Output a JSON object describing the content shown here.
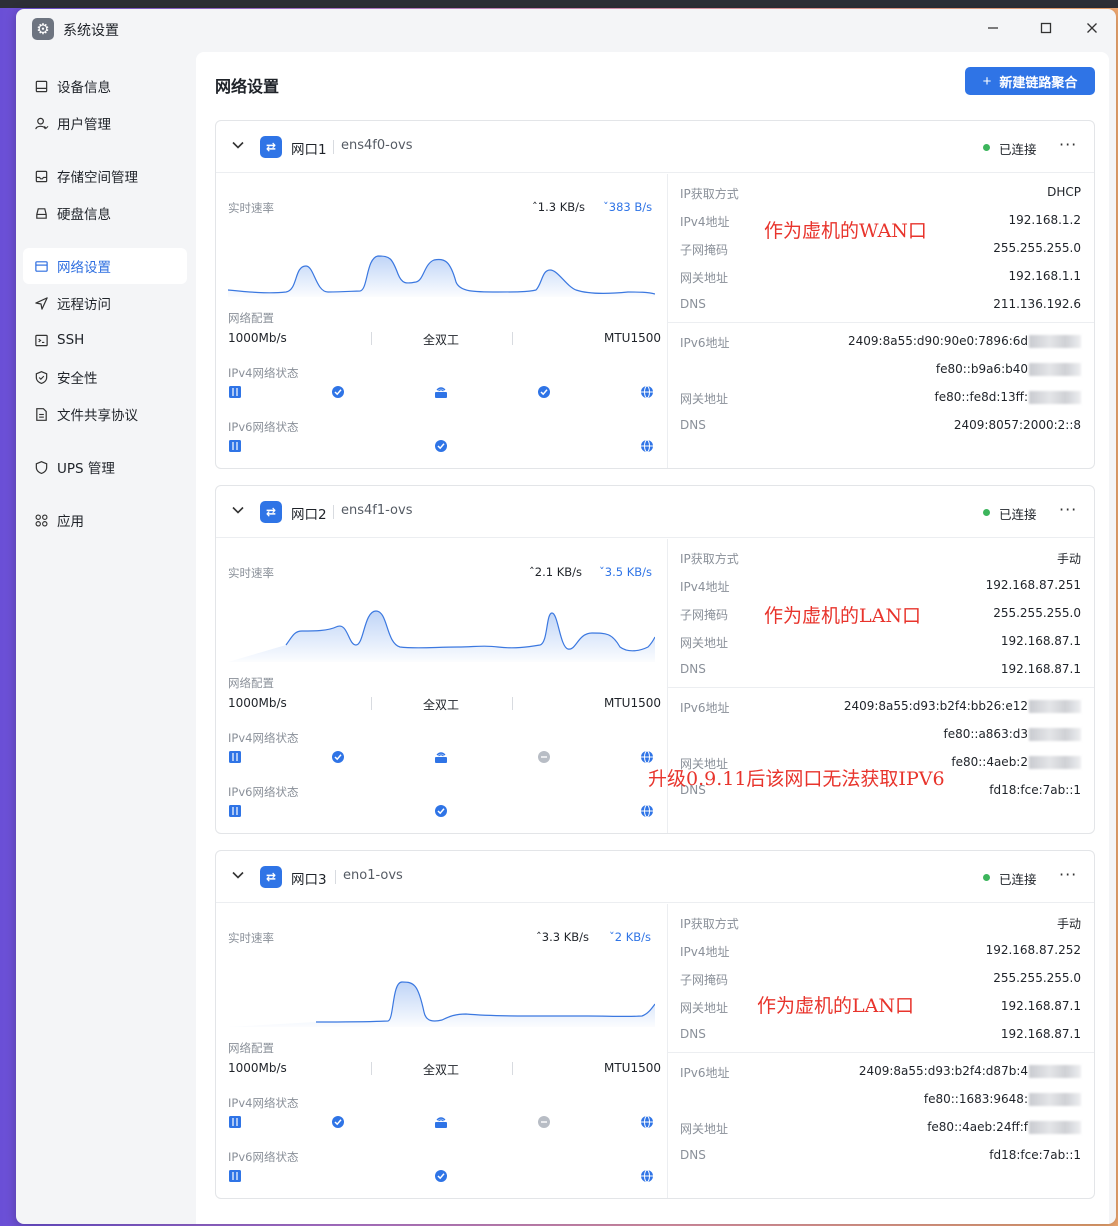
{
  "window": {
    "title": "系统设置"
  },
  "sidebar": {
    "items": [
      {
        "label": "设备信息"
      },
      {
        "label": "用户管理"
      },
      {
        "label": "存储空间管理"
      },
      {
        "label": "硬盘信息"
      },
      {
        "label": "网络设置"
      },
      {
        "label": "远程访问"
      },
      {
        "label": "SSH"
      },
      {
        "label": "安全性"
      },
      {
        "label": "文件共享协议"
      },
      {
        "label": "UPS 管理"
      },
      {
        "label": "应用"
      }
    ],
    "active_index": 4
  },
  "main": {
    "title": "网络设置",
    "new_button": "新建链路聚合"
  },
  "labels": {
    "realtime_speed": "实时速率",
    "net_config": "网络配置",
    "ipv4_status": "IPv4网络状态",
    "ipv6_status": "IPv6网络状态",
    "ip_method": "IP获取方式",
    "ipv4_addr": "IPv4地址",
    "subnet": "子网掩码",
    "gateway": "网关地址",
    "dns": "DNS",
    "ipv6_addr": "IPv6地址"
  },
  "ports": [
    {
      "name": "网口1",
      "device": "ens4f0-ovs",
      "status": "已连接",
      "speed_up": "1.3 KB/s",
      "speed_down": "383 B/s",
      "link_speed": "1000Mb/s",
      "duplex": "全双工",
      "mtu": "MTU1500",
      "ipv4_gateway_reachable": true,
      "ip_method": "DHCP",
      "ipv4": "192.168.1.2",
      "subnet": "255.255.255.0",
      "gateway": "192.168.1.1",
      "dns": "211.136.192.6",
      "ipv6_1": "2409:8a55:d90:90e0:7896:6d",
      "ipv6_2": "fe80::b9a6:b40",
      "ipv6_gateway": "fe80::fe8d:13ff:",
      "ipv6_dns": "2409:8057:2000:2::8",
      "annotation": "作为虚机的WAN口"
    },
    {
      "name": "网口2",
      "device": "ens4f1-ovs",
      "status": "已连接",
      "speed_up": "2.1 KB/s",
      "speed_down": "3.5 KB/s",
      "link_speed": "1000Mb/s",
      "duplex": "全双工",
      "mtu": "MTU1500",
      "ipv4_gateway_reachable": false,
      "ip_method": "手动",
      "ipv4": "192.168.87.251",
      "subnet": "255.255.255.0",
      "gateway": "192.168.87.1",
      "dns": "192.168.87.1",
      "ipv6_1": "2409:8a55:d93:b2f4:bb26:e12",
      "ipv6_2": "fe80::a863:d3",
      "ipv6_gateway": "fe80::4aeb:2",
      "ipv6_dns": "fd18:fce:7ab::1",
      "annotation": "作为虚机的LAN口",
      "annotation2": "升级0.9.11后该网口无法获取IPV6"
    },
    {
      "name": "网口3",
      "device": "eno1-ovs",
      "status": "已连接",
      "speed_up": "3.3 KB/s",
      "speed_down": "2 KB/s",
      "link_speed": "1000Mb/s",
      "duplex": "全双工",
      "mtu": "MTU1500",
      "ipv4_gateway_reachable": false,
      "ip_method": "手动",
      "ipv4": "192.168.87.252",
      "subnet": "255.255.255.0",
      "gateway": "192.168.87.1",
      "dns": "192.168.87.1",
      "ipv6_1": "2409:8a55:d93:b2f4:d87b:4",
      "ipv6_2": "fe80::1683:9648:",
      "ipv6_gateway": "fe80::4aeb:24ff:f",
      "ipv6_dns": "fd18:fce:7ab::1",
      "annotation": "作为虚机的LAN口"
    }
  ]
}
